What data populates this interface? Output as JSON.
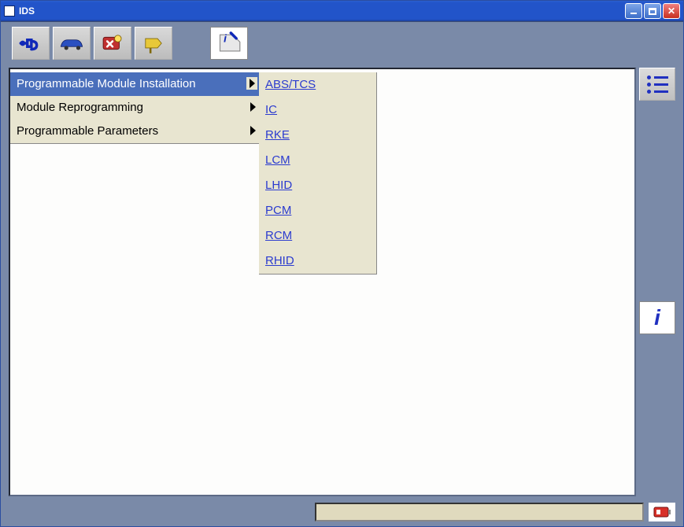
{
  "window": {
    "title": "IDS"
  },
  "toolbar": {
    "buttons": [
      {
        "name": "connect-tool",
        "icon": "plug"
      },
      {
        "name": "vehicle-tool",
        "icon": "car"
      },
      {
        "name": "module-config-tool",
        "icon": "toolcard"
      },
      {
        "name": "traffic-tool",
        "icon": "arrow-sign"
      }
    ],
    "extra_button": {
      "name": "tag-tool",
      "icon": "tag-i"
    }
  },
  "menu": {
    "items": [
      {
        "label": "Programmable Module Installation",
        "selected": true
      },
      {
        "label": "Module Reprogramming",
        "selected": false
      },
      {
        "label": "Programmable Parameters",
        "selected": false
      }
    ]
  },
  "submenu": {
    "items": [
      {
        "label": "ABS/TCS"
      },
      {
        "label": "IC"
      },
      {
        "label": "RKE"
      },
      {
        "label": "LCM"
      },
      {
        "label": "LHID"
      },
      {
        "label": "PCM"
      },
      {
        "label": "RCM"
      },
      {
        "label": "RHID"
      }
    ]
  },
  "sidebar": {
    "list_button_name": "list-view-button",
    "info_button_label": "i",
    "info_button_name": "info-button"
  },
  "status": {
    "device_icon": "vcm-device-icon"
  }
}
